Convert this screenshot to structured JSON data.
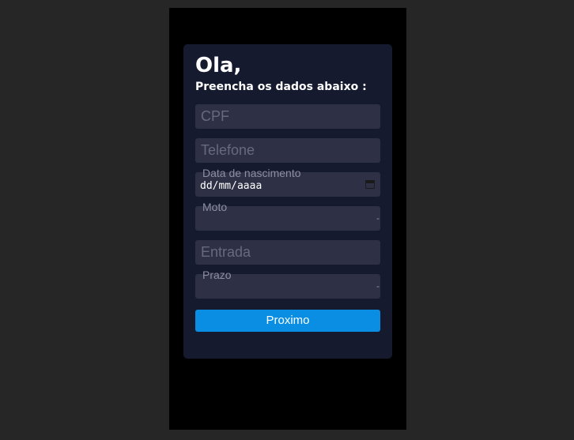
{
  "header": {
    "greeting": "Ola,",
    "subtitle": "Preencha os dados abaixo :"
  },
  "form": {
    "cpf_placeholder": "CPF",
    "telefone_placeholder": "Telefone",
    "nascimento_label": "Data de nascimento",
    "nascimento_value": "dd/mm/aaaa",
    "moto_label": "Moto",
    "moto_value": "-",
    "entrada_placeholder": "Entrada",
    "prazo_label": "Prazo",
    "prazo_value": "-",
    "submit_label": "Proximo"
  },
  "colors": {
    "background": "#262626",
    "phone": "#000000",
    "card": "#161a2e",
    "field": "#2e3146",
    "accent": "#0a8ee3",
    "text": "#ffffff",
    "placeholder": "#666a80"
  },
  "icons": {
    "date_picker": "calendar-icon",
    "select_indicator": "dash-icon"
  }
}
